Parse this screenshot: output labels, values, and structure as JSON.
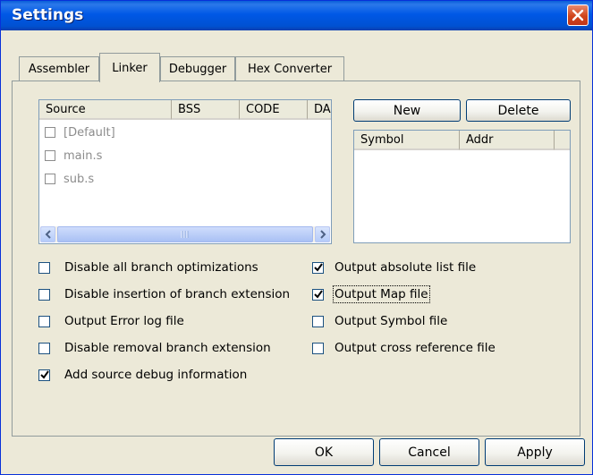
{
  "window": {
    "title": "Settings"
  },
  "tabs": [
    {
      "label": "Assembler"
    },
    {
      "label": "Linker",
      "active": true
    },
    {
      "label": "Debugger"
    },
    {
      "label": "Hex Converter"
    }
  ],
  "source_list": {
    "columns": [
      "Source",
      "BSS",
      "CODE",
      "DA"
    ],
    "rows": [
      "[Default]",
      "main.s",
      "sub.s"
    ]
  },
  "symbols": {
    "new_label": "New",
    "delete_label": "Delete",
    "columns": [
      "Symbol",
      "Addr"
    ]
  },
  "options_left": [
    {
      "label": "Disable all branch optimizations",
      "checked": false
    },
    {
      "label": "Disable insertion of branch extension",
      "checked": false
    },
    {
      "label": "Output Error log file",
      "checked": false
    },
    {
      "label": "Disable removal branch extension",
      "checked": false
    },
    {
      "label": "Add source debug information",
      "checked": true
    }
  ],
  "options_right": [
    {
      "label": "Output absolute list file",
      "checked": true
    },
    {
      "label": "Output Map file",
      "checked": true,
      "focused": true
    },
    {
      "label": "Output Symbol file",
      "checked": false
    },
    {
      "label": "Output cross reference file",
      "checked": false
    }
  ],
  "buttons": {
    "ok": "OK",
    "cancel": "Cancel",
    "apply": "Apply"
  },
  "colors": {
    "titlebar": "#0058e6",
    "dialog_bg": "#ece9d8",
    "close": "#d0451b"
  },
  "icons": [
    "close-icon",
    "scroll-left-icon",
    "scroll-right-icon",
    "checkmark-icon"
  ]
}
